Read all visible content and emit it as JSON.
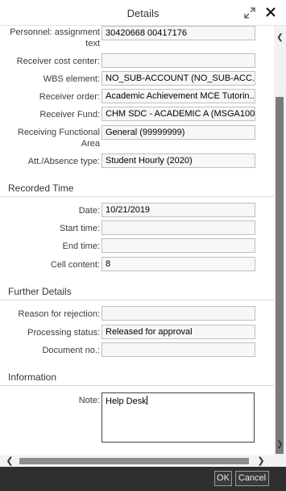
{
  "window": {
    "title": "Details"
  },
  "fields_top": [
    {
      "label": "Personnel: assignment text",
      "value": "30420668 00417176"
    },
    {
      "label": "Receiver cost center:",
      "value": ""
    },
    {
      "label": "WBS element:",
      "value": "NO_SUB-ACCOUNT (NO_SUB-ACC..."
    },
    {
      "label": "Receiver order:",
      "value": "Academic Achievement MCE Tutorin..."
    },
    {
      "label": "Receiver Fund:",
      "value": "CHM SDC - ACADEMIC A (MSGA100..."
    },
    {
      "label": "Receiving Functional Area",
      "value": "General (99999999)"
    },
    {
      "label": "Att./Absence type:",
      "value": "Student Hourly (2020)"
    }
  ],
  "recorded_time": {
    "title": "Recorded Time",
    "fields": [
      {
        "label": "Date:",
        "value": "10/21/2019"
      },
      {
        "label": "Start time:",
        "value": ""
      },
      {
        "label": "End time:",
        "value": ""
      },
      {
        "label": "Cell content:",
        "value": "8"
      }
    ]
  },
  "further_details": {
    "title": "Further Details",
    "fields": [
      {
        "label": "Reason for rejection:",
        "value": ""
      },
      {
        "label": "Processing status:",
        "value": "Released for approval"
      },
      {
        "label": "Document no.:",
        "value": ""
      }
    ]
  },
  "information": {
    "title": "Information",
    "note_label": "Note:",
    "note_value": "Help Desk"
  },
  "footer": {
    "ok_label": "OK",
    "cancel_label": "Cancel"
  },
  "icons": {
    "expand": "expand-icon",
    "close": "close-icon"
  }
}
